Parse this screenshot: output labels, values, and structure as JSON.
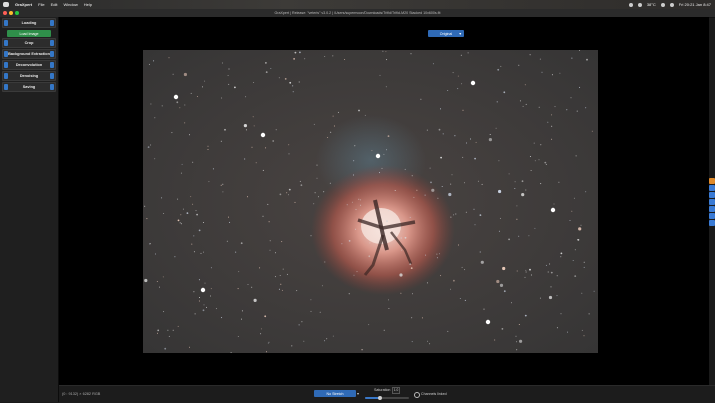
{
  "menubar": {
    "app_name": "GraXpert",
    "items": [
      "File",
      "Edit",
      "Window",
      "Help"
    ],
    "status": {
      "temperature": "38°C",
      "clock": "Fri 20:21 Jan 8:47"
    }
  },
  "window": {
    "title": "GraXpert | Release: \"veteris\" v3.0.2 | /Users/supermoon/Downloads/Trifid/Trifid-M20 Stacked 10x600s.fit"
  },
  "sidebar": {
    "sections": [
      {
        "label": "Loading"
      },
      {
        "label": "Crop"
      },
      {
        "label": "Background Extraction"
      },
      {
        "label": "Deconvolution"
      },
      {
        "label": "Denoising"
      },
      {
        "label": "Saving"
      }
    ],
    "load_button": "Load Image"
  },
  "viewer": {
    "display_mode": "Original"
  },
  "bottombar": {
    "dimensions": "(0 : 9132) × 6282 RGB",
    "stretch_option": "No Stretch",
    "saturation_label": "Saturation",
    "saturation_value": "1.0",
    "saturation_level": 0.35,
    "channels_linked_label": "Channels linked"
  },
  "colors": {
    "accent_blue": "#2f6ab6",
    "load_green": "#2f8f4a",
    "edge_tab_orange": "#e08a2a",
    "edge_tab_blue": "#3a7bd5",
    "nebula_core": "#f2d6cf",
    "nebula_glow": "#c4675a"
  }
}
